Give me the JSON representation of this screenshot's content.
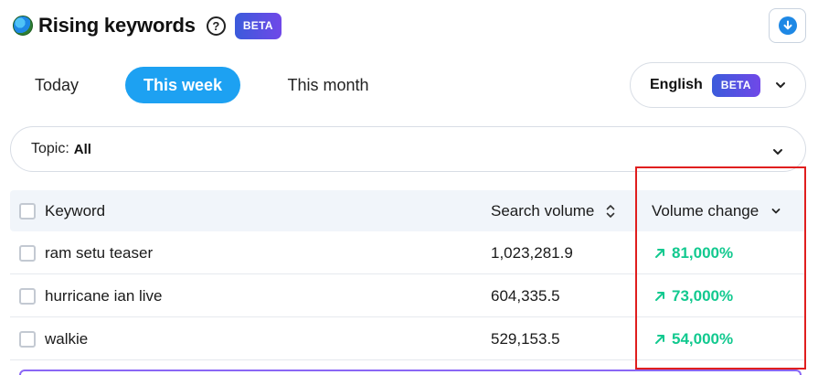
{
  "header": {
    "title": "Rising keywords",
    "help_icon_text": "?",
    "beta_label": "BETA",
    "icons": {
      "globe": "globe-icon",
      "help": "question-circle-icon",
      "download": "download-icon"
    }
  },
  "tabs": [
    {
      "label": "Today",
      "active": false
    },
    {
      "label": "This week",
      "active": true
    },
    {
      "label": "This month",
      "active": false
    }
  ],
  "language": {
    "label": "English",
    "badge": "BETA",
    "icon": "chevron-down-icon"
  },
  "topic": {
    "label": "Topic:",
    "value": "All",
    "icon": "chevron-down-icon"
  },
  "table": {
    "columns": [
      {
        "label": "Keyword"
      },
      {
        "label": "Search volume",
        "icon": "sort-icon"
      },
      {
        "label": "Volume change",
        "icon": "chevron-down-icon"
      }
    ],
    "rows": [
      {
        "keyword": "ram setu teaser",
        "search_volume": "1,023,281.9",
        "volume_change": "81,000%"
      },
      {
        "keyword": "hurricane ian live",
        "search_volume": "604,335.5",
        "volume_change": "73,000%"
      },
      {
        "keyword": "walkie",
        "search_volume": "529,153.5",
        "volume_change": "54,000%"
      }
    ]
  },
  "colors": {
    "accent_blue": "#1da1f2",
    "beta_gradient_start": "#3b5bdb",
    "beta_gradient_end": "#7048e8",
    "positive_change": "#12c98f",
    "highlight_box": "#e01e1e"
  }
}
